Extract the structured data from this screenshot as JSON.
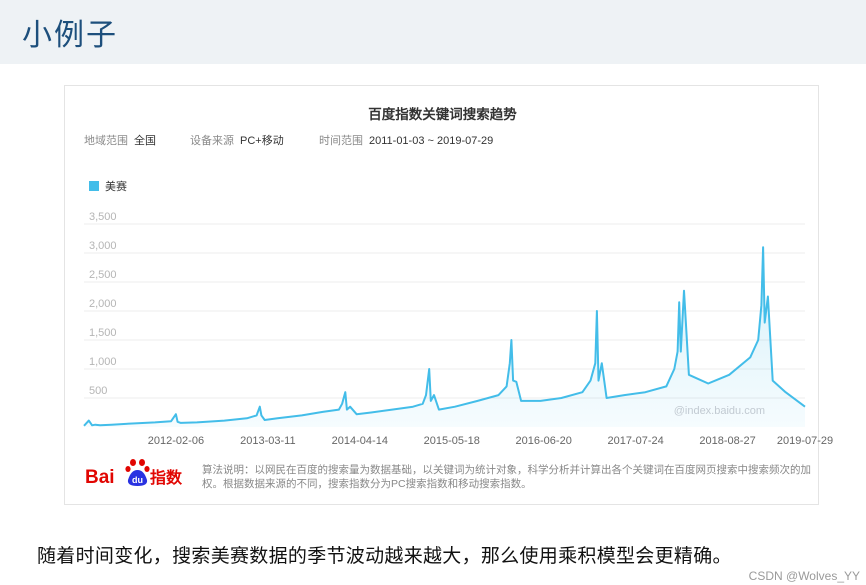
{
  "header": {
    "title": "小例子"
  },
  "chart_data": {
    "type": "line",
    "title": "百度指数关键词搜索趋势",
    "meta": [
      {
        "label": "地域范围",
        "value": "全国"
      },
      {
        "label": "设备来源",
        "value": "PC+移动"
      },
      {
        "label": "时间范围",
        "value": "2011-01-03 ~ 2019-07-29"
      }
    ],
    "legend": [
      {
        "name": "美赛",
        "color": "#43bde9"
      }
    ],
    "x_tick_labels": [
      "2012-02-06",
      "2013-03-11",
      "2014-04-14",
      "2015-05-18",
      "2016-06-20",
      "2017-07-24",
      "2018-08-27",
      "2019-07-29"
    ],
    "y_ticks": [
      500,
      1000,
      1500,
      2000,
      2500,
      3000,
      3500
    ],
    "ylim": [
      0,
      3500
    ],
    "grid": true,
    "watermark": "@index.baidu.com",
    "series": [
      {
        "name": "美赛",
        "color": "#43bde9",
        "x": [
          "2011-01-03",
          "2011-01-24",
          "2011-02-07",
          "2011-02-21",
          "2011-03-14",
          "2011-05-02",
          "2011-08-01",
          "2011-11-07",
          "2012-01-16",
          "2012-02-06",
          "2012-02-13",
          "2012-02-27",
          "2012-05-07",
          "2012-09-03",
          "2012-12-10",
          "2013-01-21",
          "2013-02-04",
          "2013-02-11",
          "2013-02-25",
          "2013-04-22",
          "2013-08-05",
          "2013-11-04",
          "2014-01-13",
          "2014-01-27",
          "2014-02-10",
          "2014-02-17",
          "2014-03-03",
          "2014-03-31",
          "2014-06-02",
          "2014-09-01",
          "2014-12-01",
          "2015-01-12",
          "2015-01-26",
          "2015-02-09",
          "2015-02-16",
          "2015-03-02",
          "2015-03-23",
          "2015-06-01",
          "2015-09-07",
          "2015-12-07",
          "2016-01-11",
          "2016-01-25",
          "2016-02-01",
          "2016-02-08",
          "2016-02-22",
          "2016-03-14",
          "2016-06-06",
          "2016-09-05",
          "2016-12-05",
          "2017-01-09",
          "2017-01-30",
          "2017-02-06",
          "2017-02-13",
          "2017-02-27",
          "2017-03-20",
          "2017-06-05",
          "2017-09-04",
          "2017-12-04",
          "2018-01-08",
          "2018-01-22",
          "2018-01-29",
          "2018-02-05",
          "2018-02-19",
          "2018-03-12",
          "2018-06-04",
          "2018-09-03",
          "2018-12-03",
          "2019-01-07",
          "2019-01-21",
          "2019-01-28",
          "2019-02-04",
          "2019-02-18",
          "2019-03-11",
          "2019-05-06",
          "2019-07-29"
        ],
        "y": [
          20,
          110,
          30,
          40,
          30,
          40,
          60,
          80,
          100,
          220,
          90,
          70,
          80,
          110,
          150,
          200,
          350,
          200,
          120,
          150,
          200,
          260,
          300,
          400,
          600,
          300,
          350,
          220,
          250,
          300,
          350,
          400,
          550,
          1000,
          450,
          550,
          300,
          350,
          450,
          550,
          700,
          1100,
          1500,
          800,
          780,
          450,
          450,
          500,
          600,
          800,
          1100,
          2000,
          800,
          1100,
          500,
          550,
          600,
          700,
          1000,
          1300,
          2150,
          1300,
          2350,
          900,
          750,
          900,
          1200,
          1500,
          2100,
          3100,
          1800,
          2250,
          800,
          600,
          350
        ]
      }
    ]
  },
  "footer": {
    "logo_text_bai": "Bai",
    "logo_text_du": "du",
    "logo_text_index": "指数",
    "note": "算法说明：以网民在百度的搜索量为数据基础，以关键词为统计对象，科学分析并计算出各个关键词在百度网页搜索中搜索频次的加权。根据数据来源的不同，搜索指数分为PC搜索指数和移动搜索指数。"
  },
  "caption": "随着时间变化，搜索美赛数据的季节波动越来越大，那么使用乘积模型会更精确。",
  "csdn_mark": "CSDN @Wolves_YY"
}
